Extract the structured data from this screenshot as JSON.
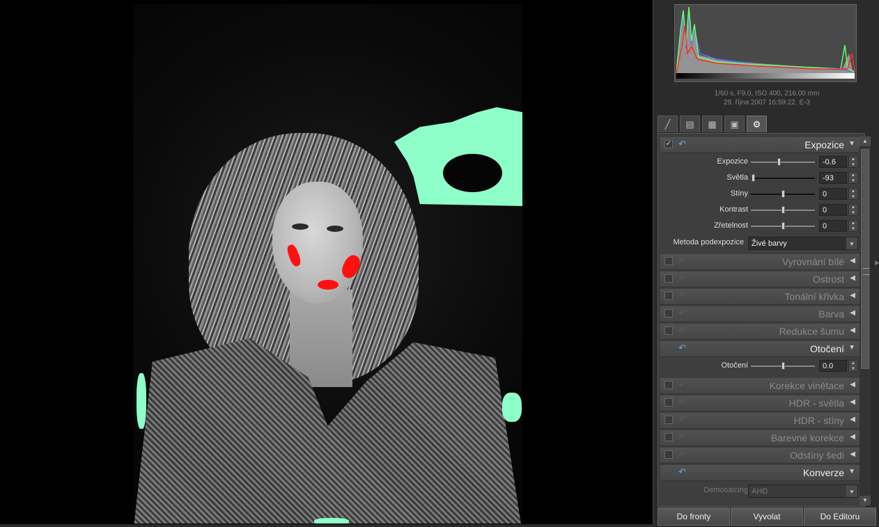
{
  "histogram": {
    "exif_line1": "1/60 s, F9.0, ISO 400, 216.00 mm",
    "exif_line2": "29. října 2007 16:59:22, E-3",
    "colors": {
      "red": "#ff2a2a",
      "green": "#6aff6a",
      "blue": "#5a6aff",
      "luma": "#e8e8e8"
    }
  },
  "tabs": [
    {
      "icon": "brush-icon"
    },
    {
      "icon": "layers-icon"
    },
    {
      "icon": "film-icon"
    },
    {
      "icon": "export-icon"
    },
    {
      "icon": "settings-gear-icon",
      "active": true
    }
  ],
  "sections": {
    "expozice": {
      "title": "Expozice",
      "enabled": true,
      "rows": [
        {
          "label": "Expozice",
          "value": "-0.6",
          "level": 0.43
        },
        {
          "label": "Světla",
          "value": "-93",
          "level": 0.035
        },
        {
          "label": "Stíny",
          "value": "0",
          "level": 0.5
        },
        {
          "label": "Kontrast",
          "value": "0",
          "level": 0.5
        },
        {
          "label": "Zřetelnost",
          "value": "0",
          "level": 0.5
        }
      ],
      "method_label": "Metoda podexpozice",
      "method_value": "Živé barvy"
    },
    "vyrovnani": {
      "title": "Vyrovnání bílé"
    },
    "ostrost": {
      "title": "Ostrost"
    },
    "tonalni": {
      "title": "Tonální křivka"
    },
    "barva": {
      "title": "Barva"
    },
    "redukce": {
      "title": "Redukce šumu"
    },
    "otoceni": {
      "title": "Otočení",
      "label": "Otočení",
      "value": "0.0",
      "level": 0.5
    },
    "vinetace": {
      "title": "Korekce vinětace"
    },
    "hdr_svetla": {
      "title": "HDR - světla"
    },
    "hdr_stiny": {
      "title": "HDR - stíny"
    },
    "barevne": {
      "title": "Barevné korekce"
    },
    "odstiny": {
      "title": "Odstíny šedi"
    },
    "konverze": {
      "title": "Konverze",
      "demosaicing_label": "Demosaicing",
      "demosaicing_value": "AHD"
    }
  },
  "buttons": {
    "queue": "Do fronty",
    "develop": "Vyvolat",
    "editor": "Do Editoru"
  },
  "icons": {
    "checked": "✓",
    "undo": "↶",
    "expanded": "▼",
    "collapsed": "◀",
    "scroll_up": "▲",
    "scroll_down": "▼",
    "panel_toggle": "▶"
  }
}
